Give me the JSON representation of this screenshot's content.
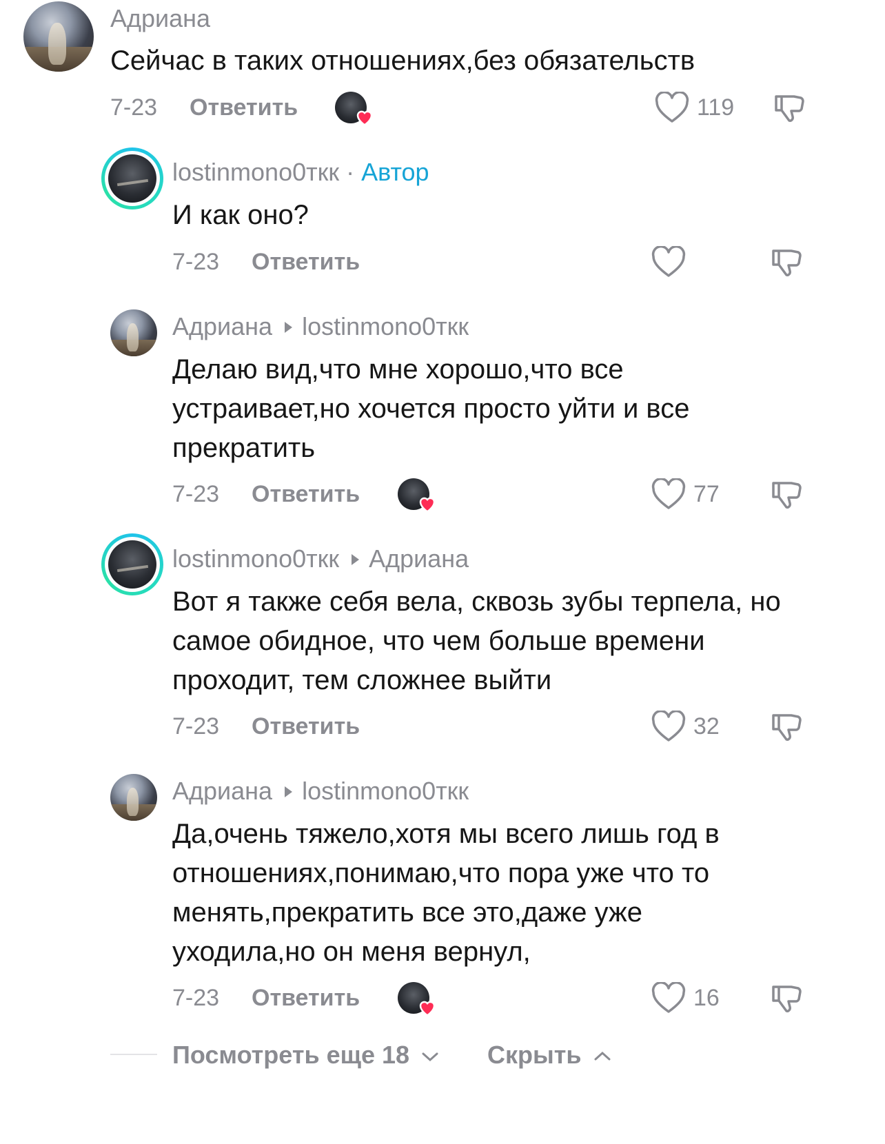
{
  "comments": [
    {
      "author": "Адриана",
      "text": "Сейчас в таких отношениях,без обязательств",
      "date": "7-23",
      "reply_label": "Ответить",
      "likes": "119",
      "creator_liked": true
    },
    {
      "author": "lostinmono0ткк",
      "author_badge": "Автор",
      "separator": " · ",
      "text": "И как оно?",
      "date": "7-23",
      "reply_label": "Ответить",
      "likes": "",
      "creator_liked": false
    },
    {
      "author": "Адриана",
      "reply_to": "lostinmono0ткк",
      "text": "Делаю вид,что мне хорошо,что все устраивает,но хочется просто уйти и все прекратить",
      "date": "7-23",
      "reply_label": "Ответить",
      "likes": "77",
      "creator_liked": true
    },
    {
      "author": "lostinmono0ткк",
      "reply_to": "Адриана",
      "text": "Вот я также себя вела, сквозь зубы терпела, но самое обидное, что чем больше времени проходит, тем сложнее выйти",
      "date": "7-23",
      "reply_label": "Ответить",
      "likes": "32",
      "creator_liked": false
    },
    {
      "author": "Адриана",
      "reply_to": "lostinmono0ткк",
      "text": "Да,очень тяжело,хотя мы всего лишь год в отношениях,понимаю,что пора уже что то менять,прекратить все это,даже уже уходила,но он меня вернул,",
      "date": "7-23",
      "reply_label": "Ответить",
      "likes": "16",
      "creator_liked": true
    }
  ],
  "footer": {
    "view_more": "Посмотреть еще 18",
    "hide": "Скрыть"
  },
  "icons": {
    "like": "heart-outline-icon",
    "dislike": "thumbs-down-icon",
    "creator_like": "creator-heart-icon",
    "expand": "chevron-down-icon",
    "collapse": "chevron-up-icon"
  },
  "colors": {
    "author_badge": "#16a4d6",
    "muted_text": "#8a8b91",
    "heart_red": "#fe2c55",
    "ring_start": "#1fc3ea",
    "ring_end": "#2ae0a9"
  }
}
